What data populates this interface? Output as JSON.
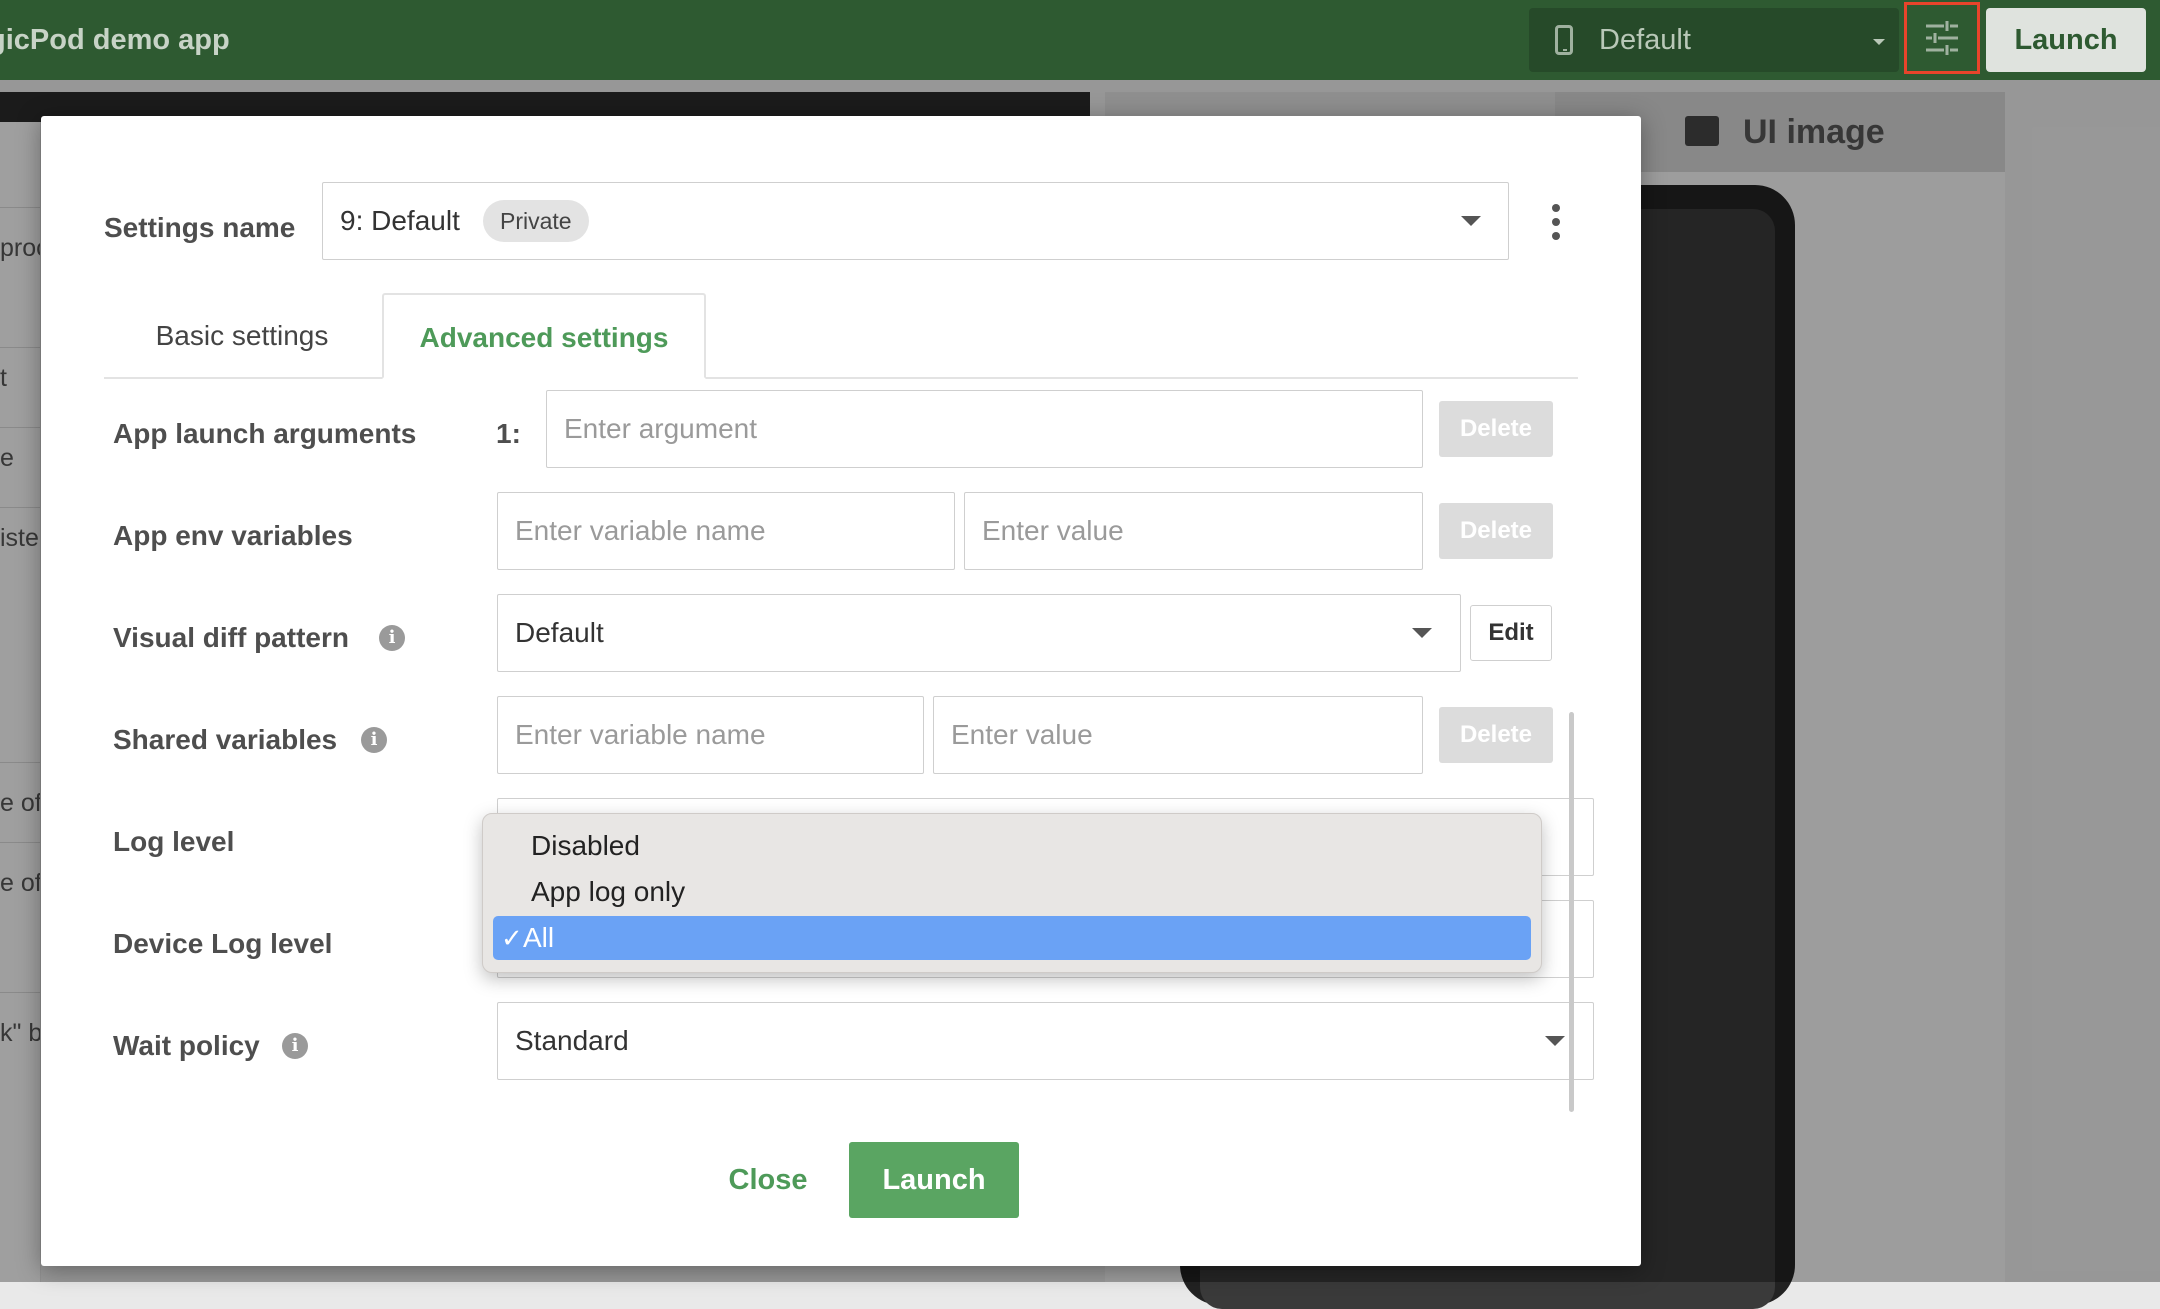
{
  "topbar": {
    "app_title": "gicPod demo app",
    "device_select": "Default",
    "launch_label": "Launch"
  },
  "background": {
    "left_rows": [
      "proc",
      "t",
      "e",
      "iste",
      "e of",
      "e of",
      "k\" b"
    ],
    "tab_ui_image": "UI image"
  },
  "modal": {
    "settings_name_label": "Settings name",
    "settings_value": "9: Default",
    "settings_badge": "Private",
    "tabs": [
      {
        "label": "Basic settings",
        "active": false
      },
      {
        "label": "Advanced settings",
        "active": true
      }
    ],
    "app_launch_arguments": {
      "label": "App launch arguments",
      "index_label": "1:",
      "placeholder": "Enter argument",
      "delete_label": "Delete"
    },
    "app_env_variables": {
      "label": "App env variables",
      "name_placeholder": "Enter variable name",
      "value_placeholder": "Enter value",
      "delete_label": "Delete"
    },
    "visual_diff_pattern": {
      "label": "Visual diff pattern",
      "value": "Default",
      "edit_label": "Edit"
    },
    "shared_variables": {
      "label": "Shared variables",
      "name_placeholder": "Enter variable name",
      "value_placeholder": "Enter value",
      "delete_label": "Delete"
    },
    "log_level": {
      "label": "Log level"
    },
    "device_log_level": {
      "label": "Device Log level"
    },
    "wait_policy": {
      "label": "Wait policy",
      "value": "Standard"
    },
    "dropdown": {
      "options": [
        "Disabled",
        "App log only",
        "All"
      ],
      "selected": "All",
      "check_glyph": "✓"
    },
    "close_label": "Close",
    "launch_label": "Launch",
    "info_glyph": "i"
  },
  "colors": {
    "topbar": "#2e5a31",
    "accent_green": "#4e9a59",
    "launch_button": "#5aa562",
    "highlight_blue": "#6aa2f5",
    "focus_red": "#e8442b"
  }
}
